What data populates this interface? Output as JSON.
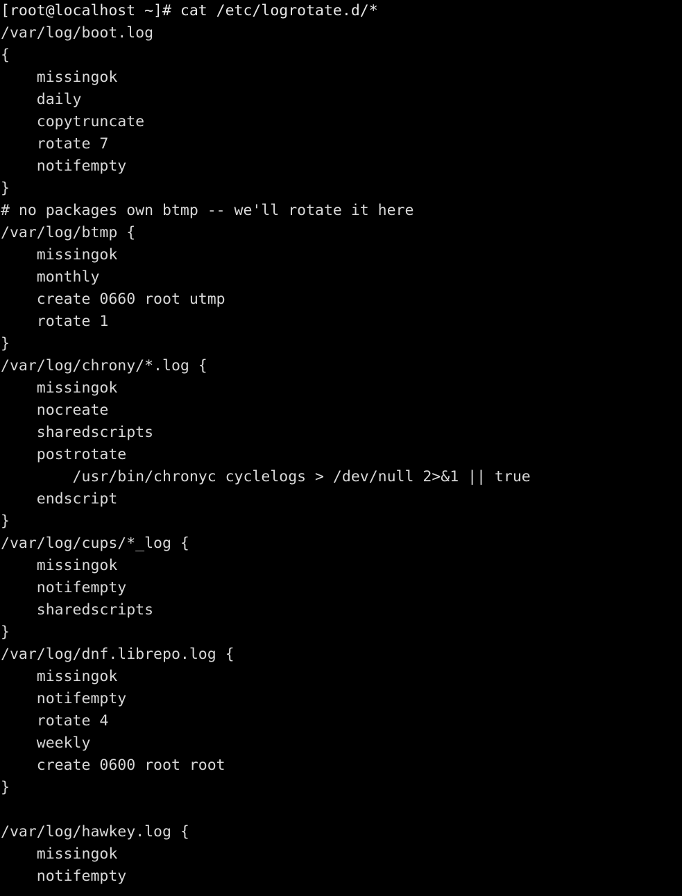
{
  "terminal": {
    "background_color": "#000000",
    "foreground_color": "#d8d8d8",
    "columns": 61,
    "rows": 40,
    "prompt": "[root@localhost ~]#",
    "command": "cat /etc/logrotate.d/*",
    "lines": [
      "[root@localhost ~]# cat /etc/logrotate.d/*",
      "/var/log/boot.log",
      "{",
      "    missingok",
      "    daily",
      "    copytruncate",
      "    rotate 7",
      "    notifempty",
      "}",
      "# no packages own btmp -- we'll rotate it here",
      "/var/log/btmp {",
      "    missingok",
      "    monthly",
      "    create 0660 root utmp",
      "    rotate 1",
      "}",
      "/var/log/chrony/*.log {",
      "    missingok",
      "    nocreate",
      "    sharedscripts",
      "    postrotate",
      "        /usr/bin/chronyc cyclelogs > /dev/null 2>&1 || true",
      "    endscript",
      "}",
      "/var/log/cups/*_log {",
      "    missingok",
      "    notifempty",
      "    sharedscripts",
      "}",
      "/var/log/dnf.librepo.log {",
      "    missingok",
      "    notifempty",
      "    rotate 4",
      "    weekly",
      "    create 0600 root root",
      "}",
      "",
      "/var/log/hawkey.log {",
      "    missingok",
      "    notifempty"
    ]
  }
}
